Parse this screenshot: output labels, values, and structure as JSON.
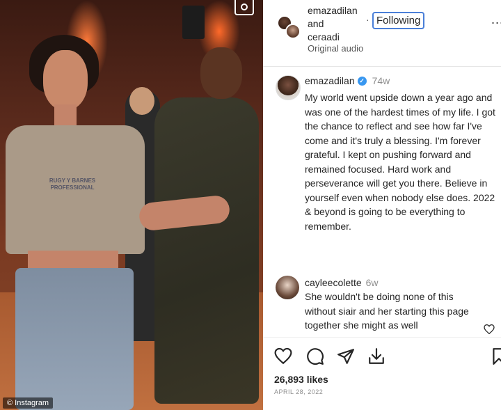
{
  "header": {
    "user1": "emazadilan",
    "conjunction": "and",
    "user2": "ceraadi",
    "separator": "·",
    "follow_label": "Following",
    "audio_label": "Original audio",
    "more_label": "..."
  },
  "caption": {
    "username": "emazadilan",
    "verified_mark": "✓",
    "time": "74w",
    "text": "My world went upside down a year ago and was one of the hardest times of my life. I got the chance to reflect and see how far I've come and it's truly a blessing. I'm forever grateful. I kept on pushing forward and remained focused. Hard work and perseverance will get you there. Believe in yourself even when nobody else does. 2022 & beyond is going to be everything to remember."
  },
  "comment": {
    "username": "cayleecolette",
    "time": "6w",
    "text": "She wouldn't be doing none of this without siair and her starting this page together she might as well"
  },
  "actions": {
    "icons": [
      "heart-icon",
      "comment-icon",
      "share-icon",
      "download-icon",
      "bookmark-icon"
    ]
  },
  "stats": {
    "likes": "26,893 likes",
    "date": "APRIL 28, 2022"
  },
  "media": {
    "credit": "© Instagram",
    "shirt_print": "RUGY Y BARNES\nPROFESSIONAL"
  },
  "colors": {
    "follow_border": "#4a7fd8",
    "verified": "#3897f0"
  }
}
